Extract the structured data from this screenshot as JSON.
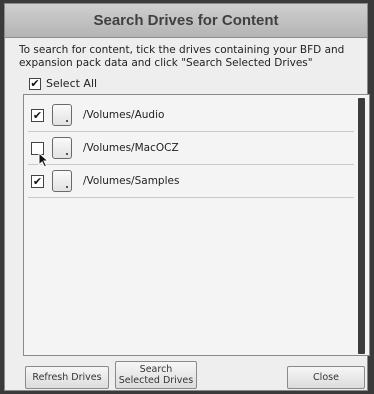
{
  "dialog": {
    "title": "Search Drives for Content",
    "instructions": "To search for content, tick the drives containing your BFD and expansion pack data and click \"Search Selected Drives\"",
    "select_all_label": "Select All",
    "select_all_checked": true
  },
  "drives": [
    {
      "path": "/Volumes/Audio",
      "checked": true
    },
    {
      "path": "/Volumes/MacOCZ",
      "checked": false
    },
    {
      "path": "/Volumes/Samples",
      "checked": true
    }
  ],
  "buttons": {
    "refresh": "Refresh Drives",
    "search_line1": "Search",
    "search_line2": "Selected Drives",
    "close": "Close"
  },
  "icons": {
    "check": "✔",
    "drive": "hard-drive-icon",
    "cursor": "mouse-pointer-icon"
  }
}
